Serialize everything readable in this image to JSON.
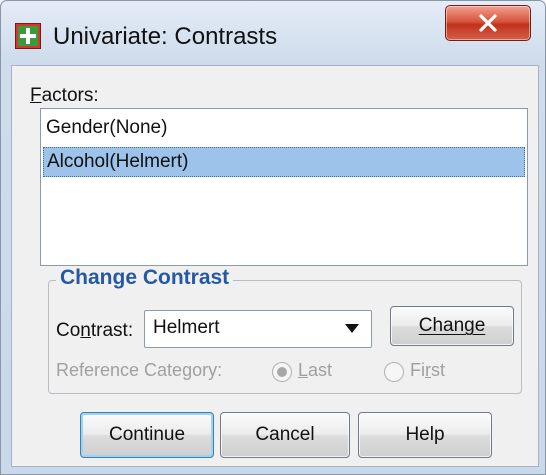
{
  "window": {
    "title": "Univariate: Contrasts",
    "icons": {
      "app": "spss-dialog-icon",
      "close": "close-icon"
    }
  },
  "factors": {
    "label_prefix": "",
    "label_accel": "F",
    "label_rest": "actors:",
    "items": [
      "Gender(None)",
      "Alcohol(Helmert)"
    ],
    "selected_index": 1
  },
  "change_contrast": {
    "title": "Change Contrast",
    "contrast_label_pre": "Co",
    "contrast_label_accel": "n",
    "contrast_label_post": "trast:",
    "contrast_value": "Helmert",
    "change_button": "Change",
    "reference_category_label": "Reference Category:",
    "reference_options": {
      "last_pre": "",
      "last_accel": "L",
      "last_post": "ast",
      "first_pre": "Fi",
      "first_accel": "r",
      "first_post": "st"
    },
    "reference_selected": "Last"
  },
  "buttons": {
    "continue": "Continue",
    "cancel": "Cancel",
    "help": "Help"
  },
  "colors": {
    "selection": "#9dc3ea",
    "group_title": "#2559a6",
    "close_button": "#c0321c"
  }
}
